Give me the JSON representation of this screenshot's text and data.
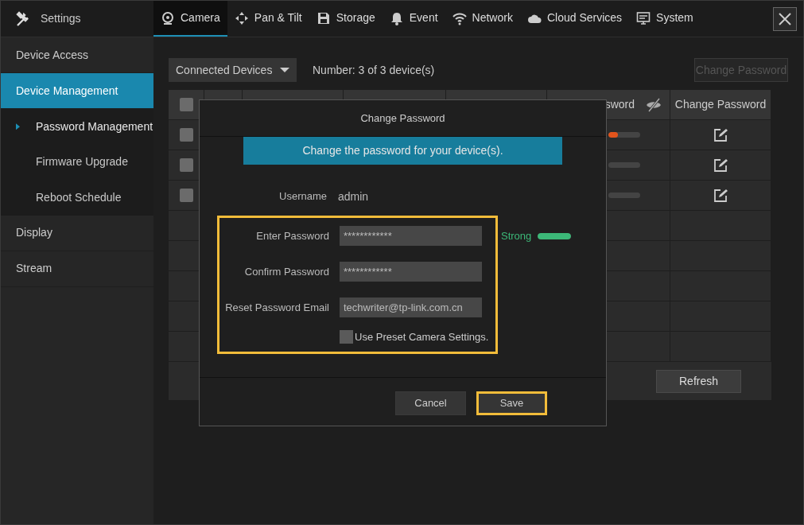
{
  "header": {
    "title": "Settings"
  },
  "tabs": [
    {
      "label": "Camera",
      "selected": true
    },
    {
      "label": "Pan & Tilt",
      "selected": false
    },
    {
      "label": "Storage",
      "selected": false
    },
    {
      "label": "Event",
      "selected": false
    },
    {
      "label": "Network",
      "selected": false
    },
    {
      "label": "Cloud Services",
      "selected": false
    },
    {
      "label": "System",
      "selected": false
    }
  ],
  "sidebar": {
    "items": [
      {
        "label": "Device Access",
        "selected": false
      },
      {
        "label": "Device Management",
        "selected": true,
        "children": [
          {
            "label": "Password Management",
            "selected": true
          },
          {
            "label": "Firmware Upgrade",
            "selected": false
          },
          {
            "label": "Reboot Schedule",
            "selected": false
          }
        ]
      },
      {
        "label": "Display",
        "selected": false
      },
      {
        "label": "Stream",
        "selected": false
      }
    ]
  },
  "toolbar": {
    "filter": "Connected Devices",
    "count": "Number: 3 of 3 device(s)",
    "button": {
      "label": "Change Password",
      "disabled": true
    }
  },
  "table": {
    "header_checked": false,
    "columns": [
      {
        "label": "sword"
      },
      {
        "label": "Change Password"
      }
    ],
    "rows": [
      {
        "checked": false,
        "level": 0.3
      },
      {
        "checked": false,
        "level": 0
      },
      {
        "checked": false,
        "level": 0
      }
    ]
  },
  "refresh_button": "Refresh",
  "dialog": {
    "title": "Change Password",
    "banner": "Change the password for your device(s).",
    "username_label": "Username",
    "username": "admin",
    "fields": [
      {
        "label": "Enter Password",
        "value": "************"
      },
      {
        "label": "Confirm Password",
        "value": "************"
      },
      {
        "label": "Reset Password Email",
        "value": "techwriter@tp-link.com.cn"
      }
    ],
    "strength": {
      "label": "Strong",
      "level": 1,
      "color": "#3cb878"
    },
    "preset": {
      "label": "Use Preset Camera Settings.",
      "checked": false
    },
    "buttons": [
      {
        "label": "Cancel",
        "highlighted": false
      },
      {
        "label": "Save",
        "highlighted": true
      }
    ]
  }
}
